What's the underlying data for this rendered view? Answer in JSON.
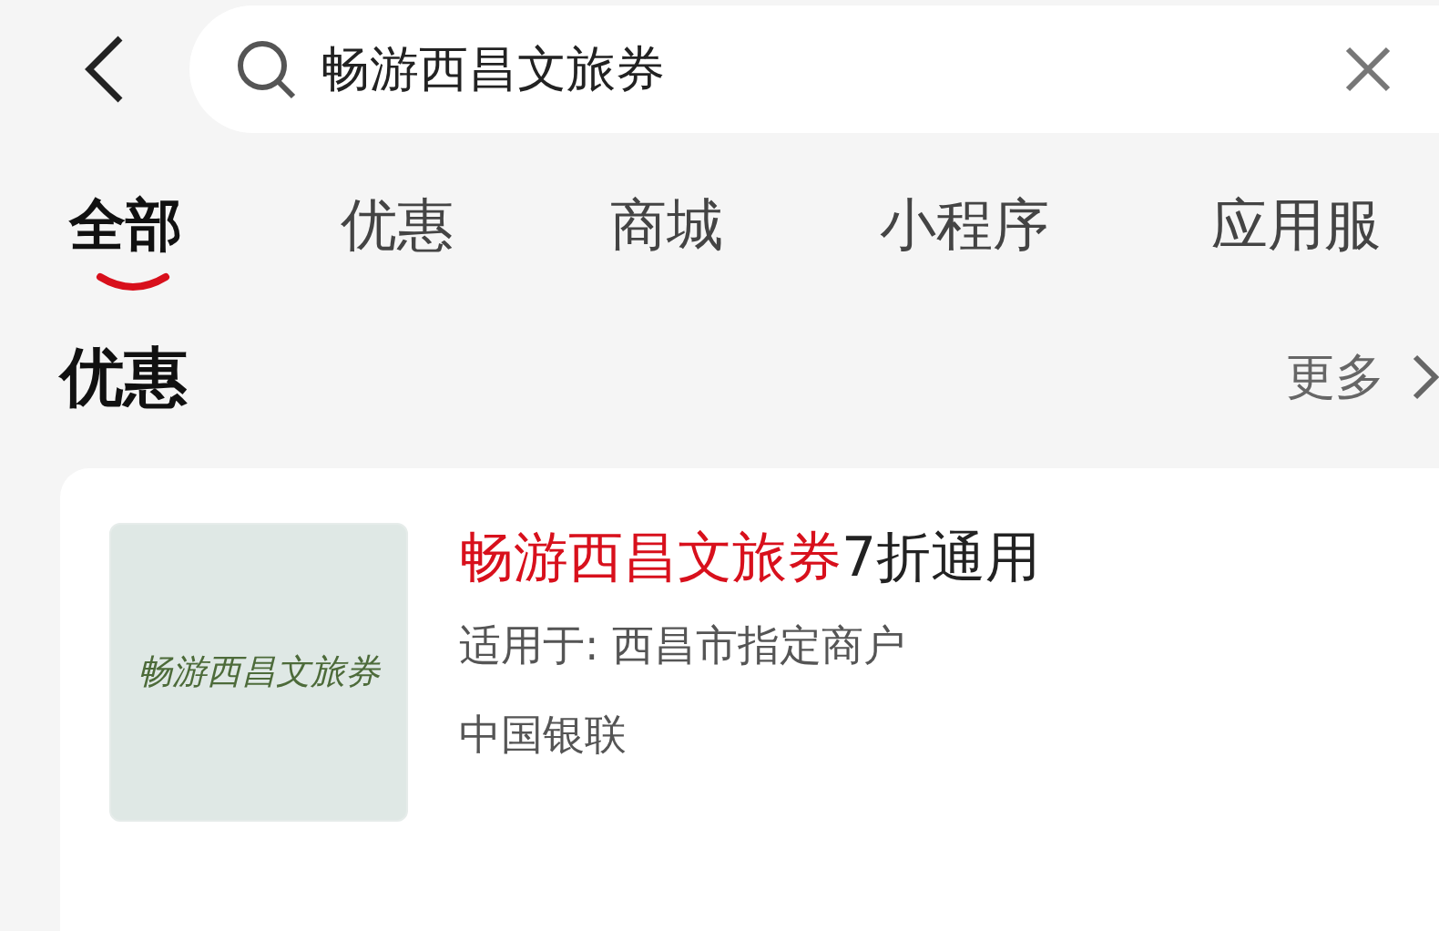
{
  "search": {
    "value": "畅游西昌文旅券"
  },
  "tabs": [
    {
      "label": "全部",
      "selected": true
    },
    {
      "label": "优惠",
      "selected": false
    },
    {
      "label": "商城",
      "selected": false
    },
    {
      "label": "小程序",
      "selected": false
    },
    {
      "label": "应用服",
      "selected": false
    }
  ],
  "section": {
    "title": "优惠",
    "more": "更多"
  },
  "card": {
    "thumbnail_text": "畅游西昌文旅券",
    "title_highlight": "畅游西昌文旅券",
    "title_rest": "7折通用",
    "scope": "适用于: 西昌市指定商户",
    "issuer": "中国银联"
  }
}
